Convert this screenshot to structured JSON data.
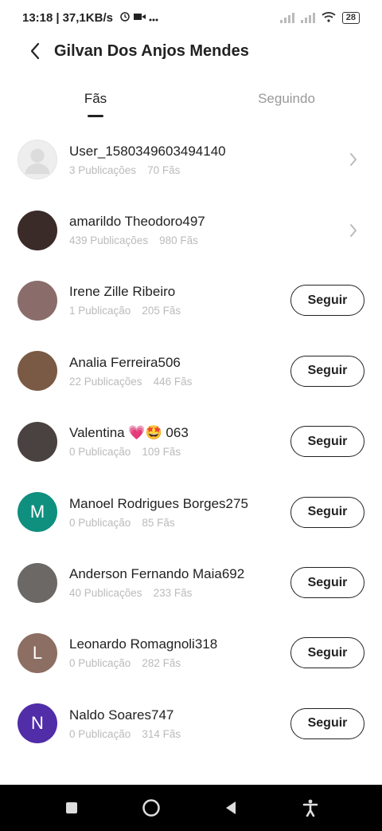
{
  "status_bar": {
    "time": "13:18",
    "speed": "37,1KB/s",
    "battery": "28"
  },
  "header": {
    "title": "Gilvan Dos Anjos Mendes"
  },
  "tabs": [
    {
      "label": "Fãs",
      "active": true
    },
    {
      "label": "Seguindo",
      "active": false
    }
  ],
  "users": [
    {
      "name": "User_1580349603494140",
      "posts": "3 Publicações",
      "fans": "70 Fãs",
      "action": "chevron",
      "avatar_color": "#eeeeee",
      "avatar_letter": ""
    },
    {
      "name": "amarildo Theodoro497",
      "posts": "439 Publicações",
      "fans": "980 Fãs",
      "action": "chevron",
      "avatar_color": "#3a2a28",
      "avatar_letter": ""
    },
    {
      "name": "Irene Zille Ribeiro",
      "posts": "1 Publicação",
      "fans": "205 Fãs",
      "action": "Seguir",
      "avatar_color": "#8a6d6a",
      "avatar_letter": ""
    },
    {
      "name": "Analia Ferreira506",
      "posts": "22 Publicações",
      "fans": "446 Fãs",
      "action": "Seguir",
      "avatar_color": "#7a5a44",
      "avatar_letter": ""
    },
    {
      "name": "Valentina 💗🤩 063",
      "posts": "0 Publicação",
      "fans": "109 Fãs",
      "action": "Seguir",
      "avatar_color": "#4a4240",
      "avatar_letter": ""
    },
    {
      "name": "Manoel Rodrigues Borges275",
      "posts": "0 Publicação",
      "fans": "85 Fãs",
      "action": "Seguir",
      "avatar_color": "#0f8f7e",
      "avatar_letter": "M"
    },
    {
      "name": "Anderson Fernando Maia692",
      "posts": "40 Publicações",
      "fans": "233 Fãs",
      "action": "Seguir",
      "avatar_color": "#6b6866",
      "avatar_letter": ""
    },
    {
      "name": "Leonardo Romagnoli318",
      "posts": "0 Publicação",
      "fans": "282 Fãs",
      "action": "Seguir",
      "avatar_color": "#8d6e63",
      "avatar_letter": "L"
    },
    {
      "name": "Naldo Soares747",
      "posts": "0 Publicação",
      "fans": "314 Fãs",
      "action": "Seguir",
      "avatar_color": "#512da8",
      "avatar_letter": "N"
    }
  ]
}
